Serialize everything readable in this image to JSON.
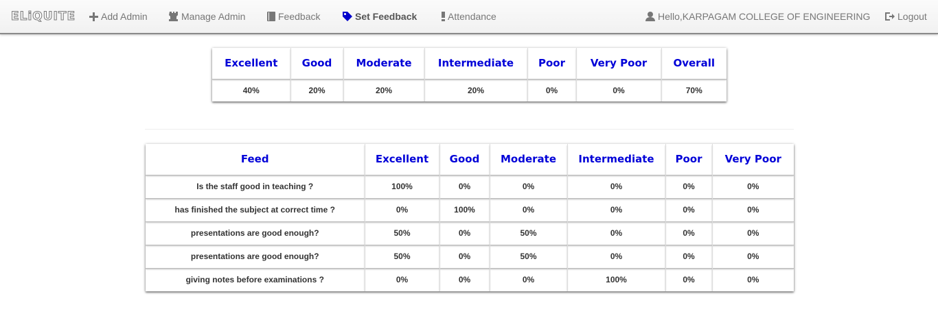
{
  "nav": {
    "brand": "ELiQUITE",
    "items": [
      {
        "label": "Add Admin",
        "icon": "plus-icon"
      },
      {
        "label": "Manage Admin",
        "icon": "chess-rook-icon"
      },
      {
        "label": "Feedback",
        "icon": "book-icon"
      },
      {
        "label": "Set Feedback",
        "icon": "tag-icon",
        "active": true
      },
      {
        "label": "Attendance",
        "icon": "exclamation-icon"
      }
    ],
    "user_label": "Hello,KARPAGAM COLLEGE OF ENGINEERING",
    "logout_label": "Logout"
  },
  "summary": {
    "headers": [
      "Excellent",
      "Good",
      "Moderate",
      "Intermediate",
      "Poor",
      "Very Poor",
      "Overall"
    ],
    "values": [
      "40%",
      "20%",
      "20%",
      "20%",
      "0%",
      "0%",
      "70%"
    ]
  },
  "feed_table": {
    "headers": [
      "Feed",
      "Excellent",
      "Good",
      "Moderate",
      "Intermediate",
      "Poor",
      "Very Poor"
    ],
    "rows": [
      [
        "Is the staff good in teaching ?",
        "100%",
        "0%",
        "0%",
        "0%",
        "0%",
        "0%"
      ],
      [
        "has finished the subject at correct time ?",
        "0%",
        "100%",
        "0%",
        "0%",
        "0%",
        "0%"
      ],
      [
        "presentations are good enough?",
        "50%",
        "0%",
        "50%",
        "0%",
        "0%",
        "0%"
      ],
      [
        "presentations are good enough?",
        "50%",
        "0%",
        "50%",
        "0%",
        "0%",
        "0%"
      ],
      [
        "giving notes before examinations ?",
        "0%",
        "0%",
        "0%",
        "100%",
        "0%",
        "0%"
      ]
    ]
  },
  "colors": {
    "header_text": "#0000d8",
    "nav_text": "#777777",
    "active_icon": "#0000cc"
  }
}
